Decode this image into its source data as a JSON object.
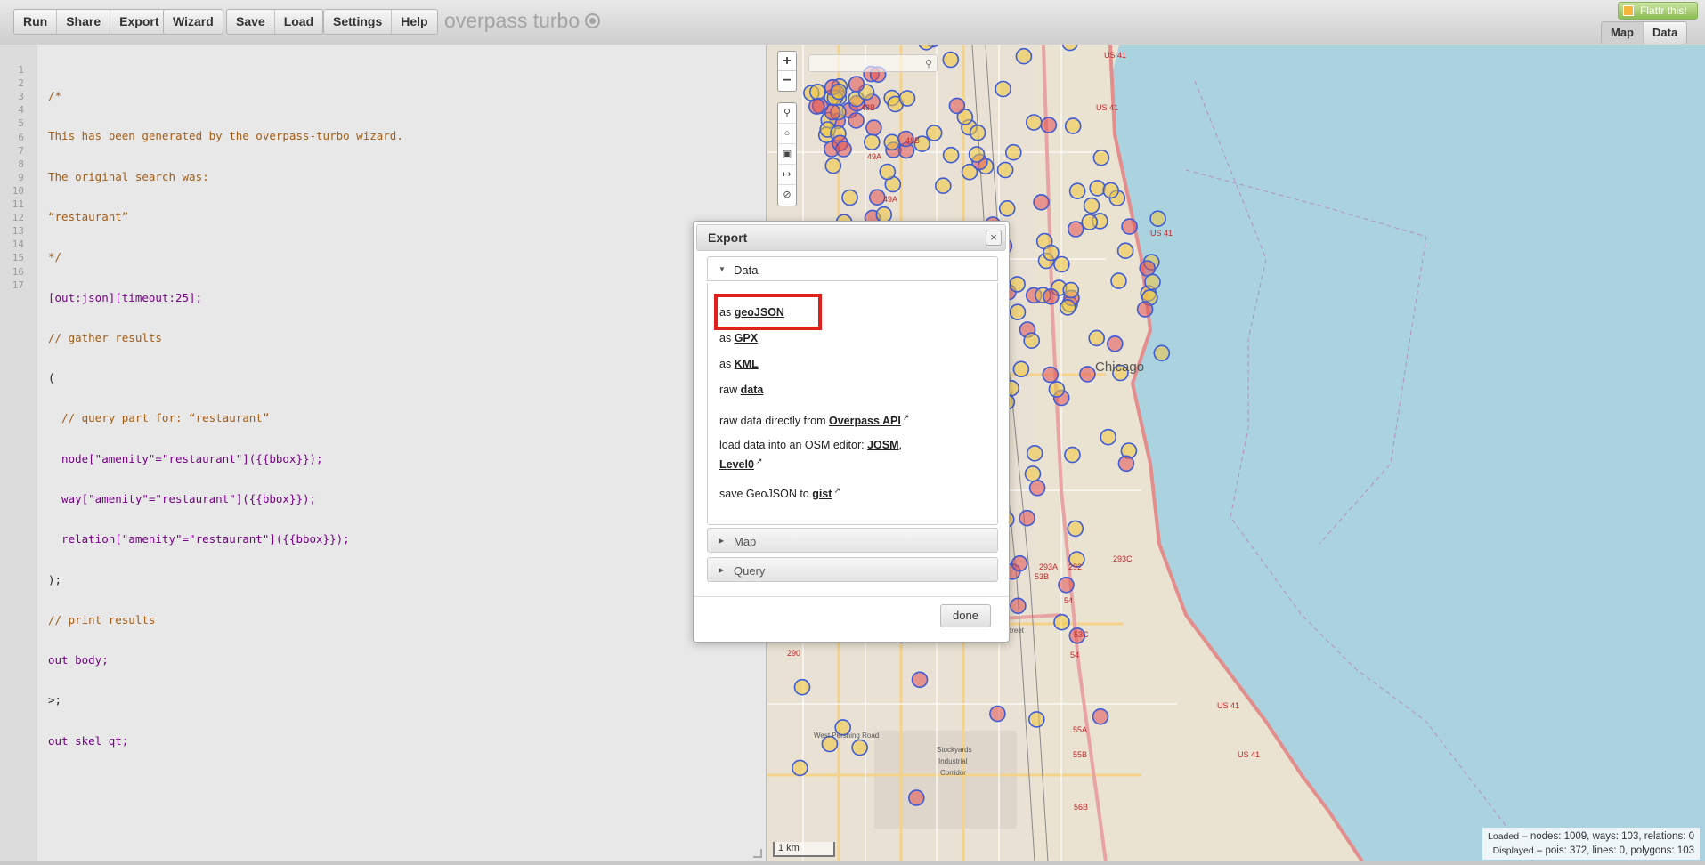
{
  "toolbar": {
    "group1": [
      "Run",
      "Share",
      "Export"
    ],
    "group2": [
      "Wizard"
    ],
    "group3": [
      "Save",
      "Load"
    ],
    "group4": [
      "Settings",
      "Help"
    ],
    "app_title": "overpass turbo",
    "flattr_label": "Flattr this!",
    "view_tabs": [
      "Map",
      "Data"
    ],
    "active_view": "Map"
  },
  "editor": {
    "line_numbers": [
      "1",
      "2",
      "3",
      "4",
      "5",
      "6",
      "7",
      "8",
      "9",
      "10",
      "11",
      "12",
      "13",
      "14",
      "15",
      "16",
      "17"
    ],
    "lines": [
      "/*",
      "This has been generated by the overpass-turbo wizard.",
      "The original search was:",
      "“restaurant”",
      "*/",
      "[out:json][timeout:25];",
      "// gather results",
      "(",
      "  // query part for: “restaurant”",
      "  node[\"amenity\"=\"restaurant\"]({{bbox}});",
      "  way[\"amenity\"=\"restaurant\"]({{bbox}});",
      "  relation[\"amenity\"=\"restaurant\"]({{bbox}});",
      ");",
      "// print results",
      "out body;",
      ">;",
      "out skel qt;"
    ]
  },
  "map": {
    "zoom_in": "+",
    "zoom_out": "−",
    "city_label": "Chicago",
    "scale_label": "1 km",
    "road_labels": [
      "US 41",
      "US 41",
      "US 41",
      "48B",
      "49A",
      "49A",
      "48B",
      "293A",
      "53B",
      "292",
      "293C",
      "54",
      "53C",
      "54",
      "290",
      "55A",
      "55B",
      "56B",
      "US 41",
      "US 41",
      "West Pershing Road",
      "Stockyards",
      "Industrial",
      "Corridor",
      "treet"
    ],
    "stats_loaded_label": "Loaded",
    "stats_loaded": "– nodes: 1009, ways: 103, relations: 0",
    "stats_displayed_label": "Displayed",
    "stats_displayed": "– pois: 372, lines: 0, polygons: 103"
  },
  "dialog": {
    "title": "Export",
    "close": "×",
    "sections": {
      "data": "Data",
      "map": "Map",
      "query": "Query"
    },
    "options": {
      "geojson_prefix": "as",
      "geojson_link": "geoJSON",
      "gpx_prefix": "as",
      "gpx_link": "GPX",
      "kml_prefix": "as",
      "kml_link": "KML",
      "raw_prefix": "raw",
      "raw_link": "data",
      "overpass_prefix": "raw data directly from",
      "overpass_link": "Overpass API",
      "editor_prefix": "load data into an OSM editor:",
      "josm_link": "JOSM",
      "level0_link": "Level0",
      "gist_prefix": "save GeoJSON to",
      "gist_link": "gist"
    },
    "done": "done"
  },
  "colors": {
    "highlight": "#e0201c",
    "poi_fill_yellow": "#f1c83c",
    "poi_fill_red": "#e05252",
    "poi_stroke": "#3d5cd6",
    "water": "#aad3df"
  }
}
